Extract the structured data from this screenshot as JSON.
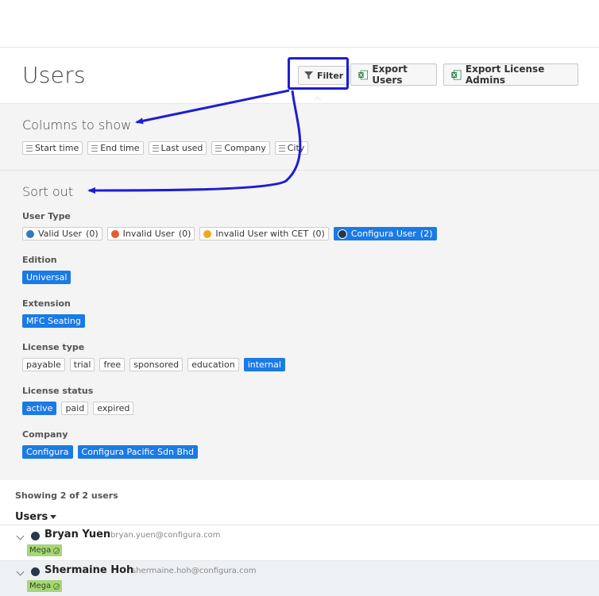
{
  "page": {
    "title": "Users"
  },
  "toolbar": {
    "filter_label": "Filter",
    "export_users_label": "Export Users",
    "export_admins_label": "Export License Admins"
  },
  "columns": {
    "heading": "Columns to show",
    "items": [
      "Start time",
      "End time",
      "Last used",
      "Company",
      "City"
    ]
  },
  "sort": {
    "heading": "Sort out",
    "user_type": {
      "label": "User Type",
      "options": [
        {
          "label": "Valid User",
          "count": "(0)",
          "color": "#2f7bbf",
          "selected": false
        },
        {
          "label": "Invalid User",
          "count": "(0)",
          "color": "#e35d2b",
          "selected": false
        },
        {
          "label": "Invalid User with CET",
          "count": "(0)",
          "color": "#f2a81d",
          "selected": false
        },
        {
          "label": "Configura User",
          "count": "(2)",
          "color": "#25384e",
          "selected": true
        }
      ]
    },
    "edition": {
      "label": "Edition",
      "options": [
        {
          "label": "Universal",
          "selected": true
        }
      ]
    },
    "extension": {
      "label": "Extension",
      "options": [
        {
          "label": "MFC Seating",
          "selected": true
        }
      ]
    },
    "license_type": {
      "label": "License type",
      "options": [
        {
          "label": "payable",
          "selected": false
        },
        {
          "label": "trial",
          "selected": false
        },
        {
          "label": "free",
          "selected": false
        },
        {
          "label": "sponsored",
          "selected": false
        },
        {
          "label": "education",
          "selected": false
        },
        {
          "label": "internal",
          "selected": true
        }
      ]
    },
    "license_status": {
      "label": "License status",
      "options": [
        {
          "label": "active",
          "selected": true
        },
        {
          "label": "paid",
          "selected": false
        },
        {
          "label": "expired",
          "selected": false
        }
      ]
    },
    "company": {
      "label": "Company",
      "options": [
        {
          "label": "Configura",
          "selected": true
        },
        {
          "label": "Configura Pacific Sdn Bhd",
          "selected": true
        }
      ]
    }
  },
  "list": {
    "showing_text": "Showing 2 of 2 users",
    "header_label": "Users",
    "users": [
      {
        "name": "Bryan Yuen",
        "email": "bryan.yuen@configura.com",
        "badge": "Mega"
      },
      {
        "name": "Shermaine Hoh",
        "email": "shermaine.hoh@configura.com",
        "badge": "Mega"
      }
    ]
  },
  "colors": {
    "accent": "#1a7ae6",
    "annotation": "#1e1ed2",
    "badge": "#a6d57a"
  }
}
